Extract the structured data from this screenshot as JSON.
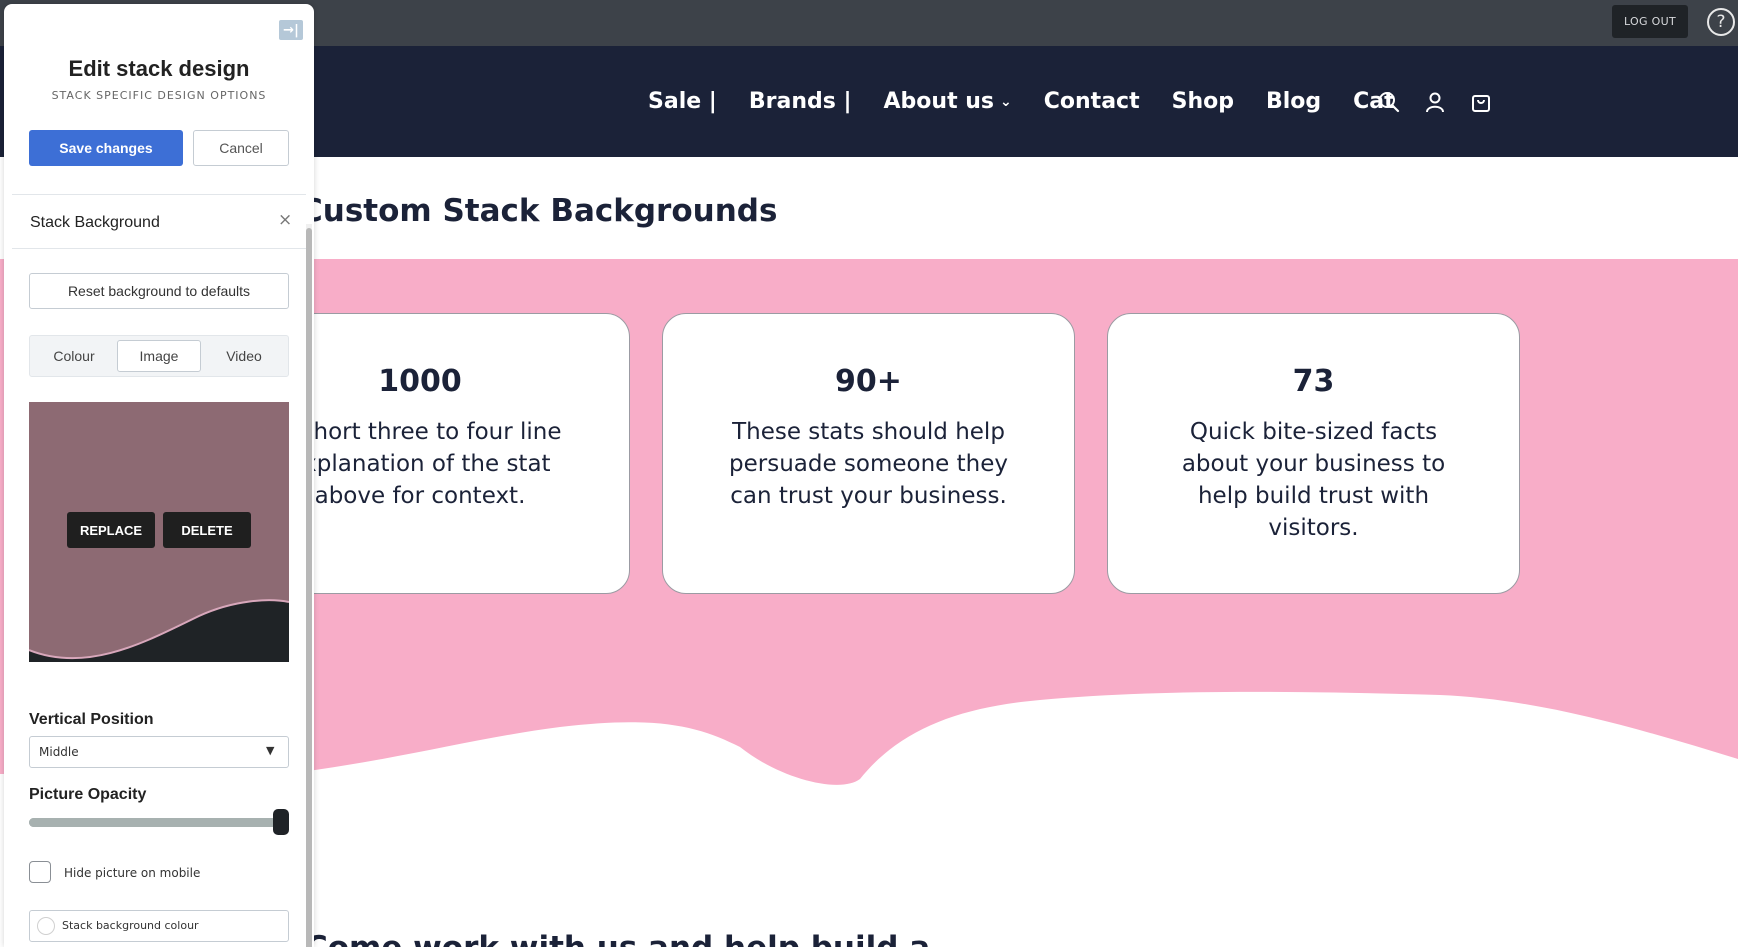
{
  "admin_bar": {
    "logout_label": "LOG OUT",
    "help_glyph": "?"
  },
  "nav": {
    "items": [
      {
        "label": "Sale |"
      },
      {
        "label": "Brands |"
      },
      {
        "label": "About us",
        "has_dropdown": true
      },
      {
        "label": "Contact"
      },
      {
        "label": "Shop"
      },
      {
        "label": "Blog"
      },
      {
        "label": "Cat"
      }
    ],
    "icons": [
      "search-icon",
      "account-icon",
      "cart-icon"
    ],
    "background": "#1b2238"
  },
  "page": {
    "section_title": "Custom Stack Backgrounds",
    "pink_colour": "#f8adc8",
    "stats": [
      {
        "value": "1000",
        "text": "A short three to four line explanation of the stat above for context."
      },
      {
        "value": "90+",
        "text": "These stats should help persuade someone they can trust your business."
      },
      {
        "value": "73",
        "text": "Quick bite-sized facts about your business to help build trust with visitors."
      }
    ],
    "bottom_heading": "Come work with us and help build a"
  },
  "editor": {
    "collapse_glyph": "→|",
    "title": "Edit stack design",
    "subtitle": "STACK SPECIFIC DESIGN OPTIONS",
    "save_label": "Save changes",
    "cancel_label": "Cancel",
    "section_title": "Stack Background",
    "close_glyph": "×",
    "reset_label": "Reset background to defaults",
    "tabs": [
      {
        "label": "Colour",
        "active": false
      },
      {
        "label": "Image",
        "active": true
      },
      {
        "label": "Video",
        "active": false
      }
    ],
    "replace_label": "REPLACE",
    "delete_label": "DELETE",
    "vertical_position_label": "Vertical Position",
    "vertical_position_value": "Middle",
    "opacity_label": "Picture Opacity",
    "opacity_value": 1.0,
    "hide_mobile_label": "Hide picture on mobile",
    "hide_mobile_checked": false,
    "bg_colour_label": "Stack background colour",
    "accent": "#3d6fd6"
  }
}
